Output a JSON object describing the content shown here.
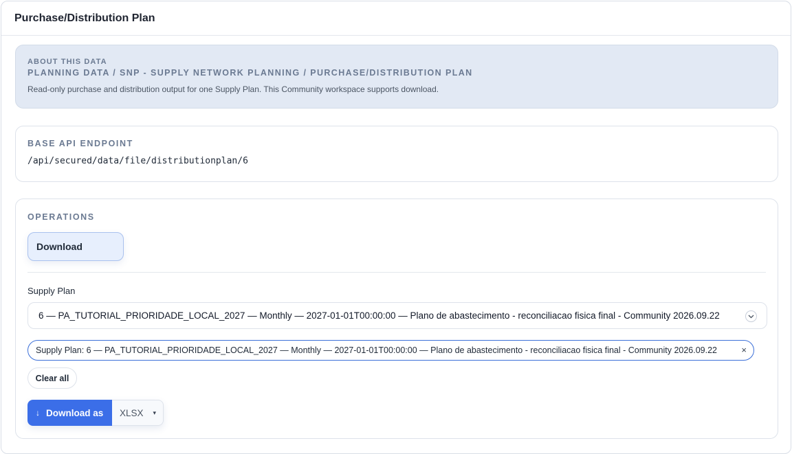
{
  "header": {
    "title": "Purchase/Distribution Plan"
  },
  "about": {
    "eyebrow": "ABOUT THIS DATA",
    "path": "PLANNING DATA / SNP - SUPPLY NETWORK PLANNING / PURCHASE/DISTRIBUTION PLAN",
    "description": "Read-only purchase and distribution output for one Supply Plan. This Community workspace supports download."
  },
  "endpoint": {
    "label": "BASE API ENDPOINT",
    "value": "/api/secured/data/file/distributionplan/6"
  },
  "operations": {
    "label": "OPERATIONS",
    "download_tab": "Download",
    "supply_plan_label": "Supply Plan",
    "supply_plan_value": "6 — PA_TUTORIAL_PRIORIDADE_LOCAL_2027 — Monthly — 2027-01-01T00:00:00 — Plano de abastecimento - reconciliacao fisica final - Community 2026.09.22",
    "chip_text": "Supply Plan: 6 — PA_TUTORIAL_PRIORIDADE_LOCAL_2027 — Monthly — 2027-01-01T00:00:00 — Plano de abastecimento - reconciliacao fisica final - Community 2026.09.22",
    "chip_close": "×",
    "clear_all": "Clear all",
    "download_as": "Download as",
    "download_arrow": "↓",
    "format": "XLSX",
    "format_caret": "▾"
  },
  "colors": {
    "accent": "#3b6ee8",
    "about_bg": "#e2e9f4",
    "download_tab_bg": "#e7effd"
  }
}
